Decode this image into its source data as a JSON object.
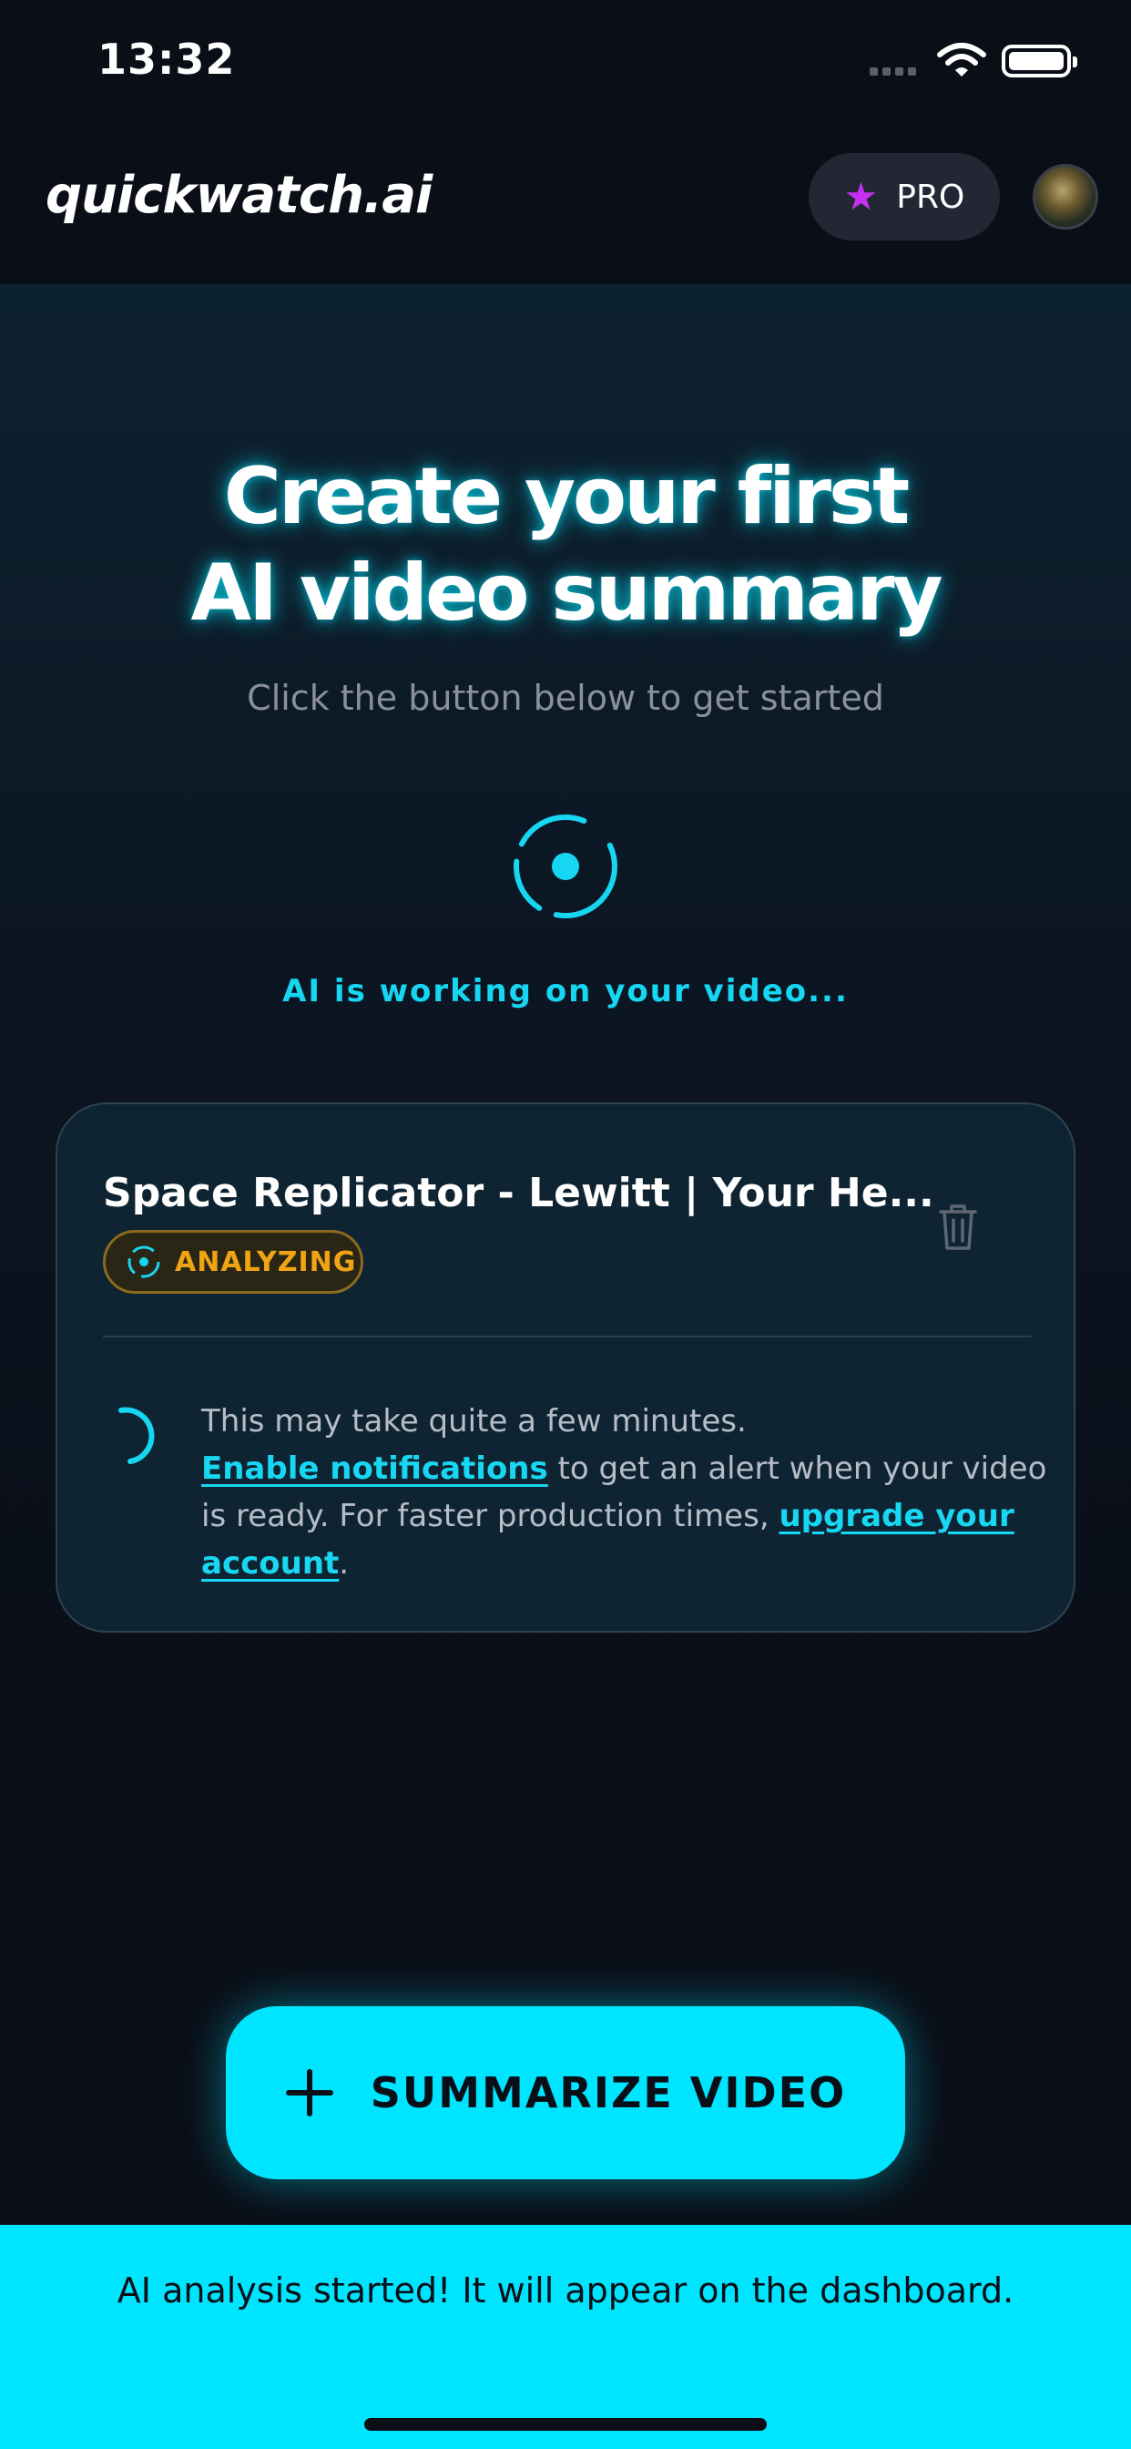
{
  "status_bar": {
    "time": "13:32"
  },
  "header": {
    "logo": "quickwatch.ai",
    "pro_label": "PRO"
  },
  "hero": {
    "title_line1": "Create your first",
    "title_line2": "AI video summary",
    "subtitle": "Click the button below to get started",
    "working_text": "AI is working on your video..."
  },
  "video_card": {
    "title": "Space Replicator - Lewitt | Your He...",
    "status": "ANALYZING",
    "info_line1": "This may take quite a few minutes.",
    "enable_notifications_link": "Enable notifications",
    "info_middle": " to get an alert when your video is ready. For faster production times, ",
    "upgrade_link": "upgrade your account",
    "info_end": "."
  },
  "summarize_button": {
    "label": "SUMMARIZE VIDEO"
  },
  "toast": {
    "message": "AI analysis started! It will appear on the dashboard."
  },
  "colors": {
    "accent": "#00e5ff",
    "background": "#0a0e17",
    "warning": "#f0a413",
    "pro_star": "#c531f2"
  },
  "icons": [
    "star-icon",
    "trash-icon",
    "plus-icon",
    "loading-spinner-icon",
    "wifi-icon",
    "battery-icon"
  ]
}
